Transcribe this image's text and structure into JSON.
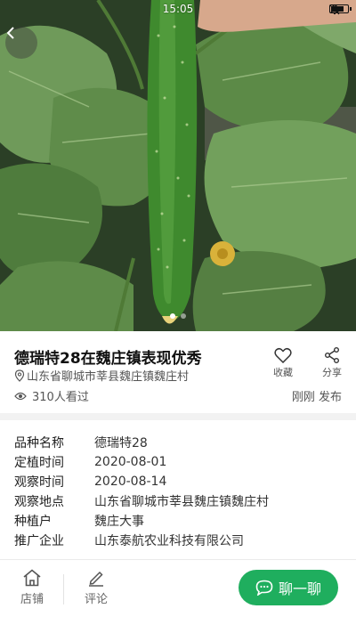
{
  "status_bar": {
    "time": "15:05",
    "battery_level": 0.8
  },
  "hero": {
    "image_count": 2,
    "active_index": 0
  },
  "post": {
    "title": "德瑞特28在魏庄镇表现优秀",
    "location": "山东省聊城市莘县魏庄镇魏庄村",
    "views": "310人看过",
    "posted": "刚刚 发布"
  },
  "actions": {
    "favorite_label": "收藏",
    "share_label": "分享"
  },
  "details": [
    {
      "key": "品种名称",
      "value": "德瑞特28"
    },
    {
      "key": "定植时间",
      "value": "2020-08-01"
    },
    {
      "key": "观察时间",
      "value": "2020-08-14"
    },
    {
      "key": "观察地点",
      "value": "山东省聊城市莘县魏庄镇魏庄村"
    },
    {
      "key": "种植户",
      "value": "魏庄大事"
    },
    {
      "key": "推广企业",
      "value": "山东泰航农业科技有限公司"
    }
  ],
  "bottom_bar": {
    "store_label": "店铺",
    "comment_label": "评论",
    "chat_label": "聊一聊"
  },
  "colors": {
    "accent": "#1fae5e",
    "leaf": "#4a7a3a",
    "cucumber": "#3f8a2e"
  }
}
